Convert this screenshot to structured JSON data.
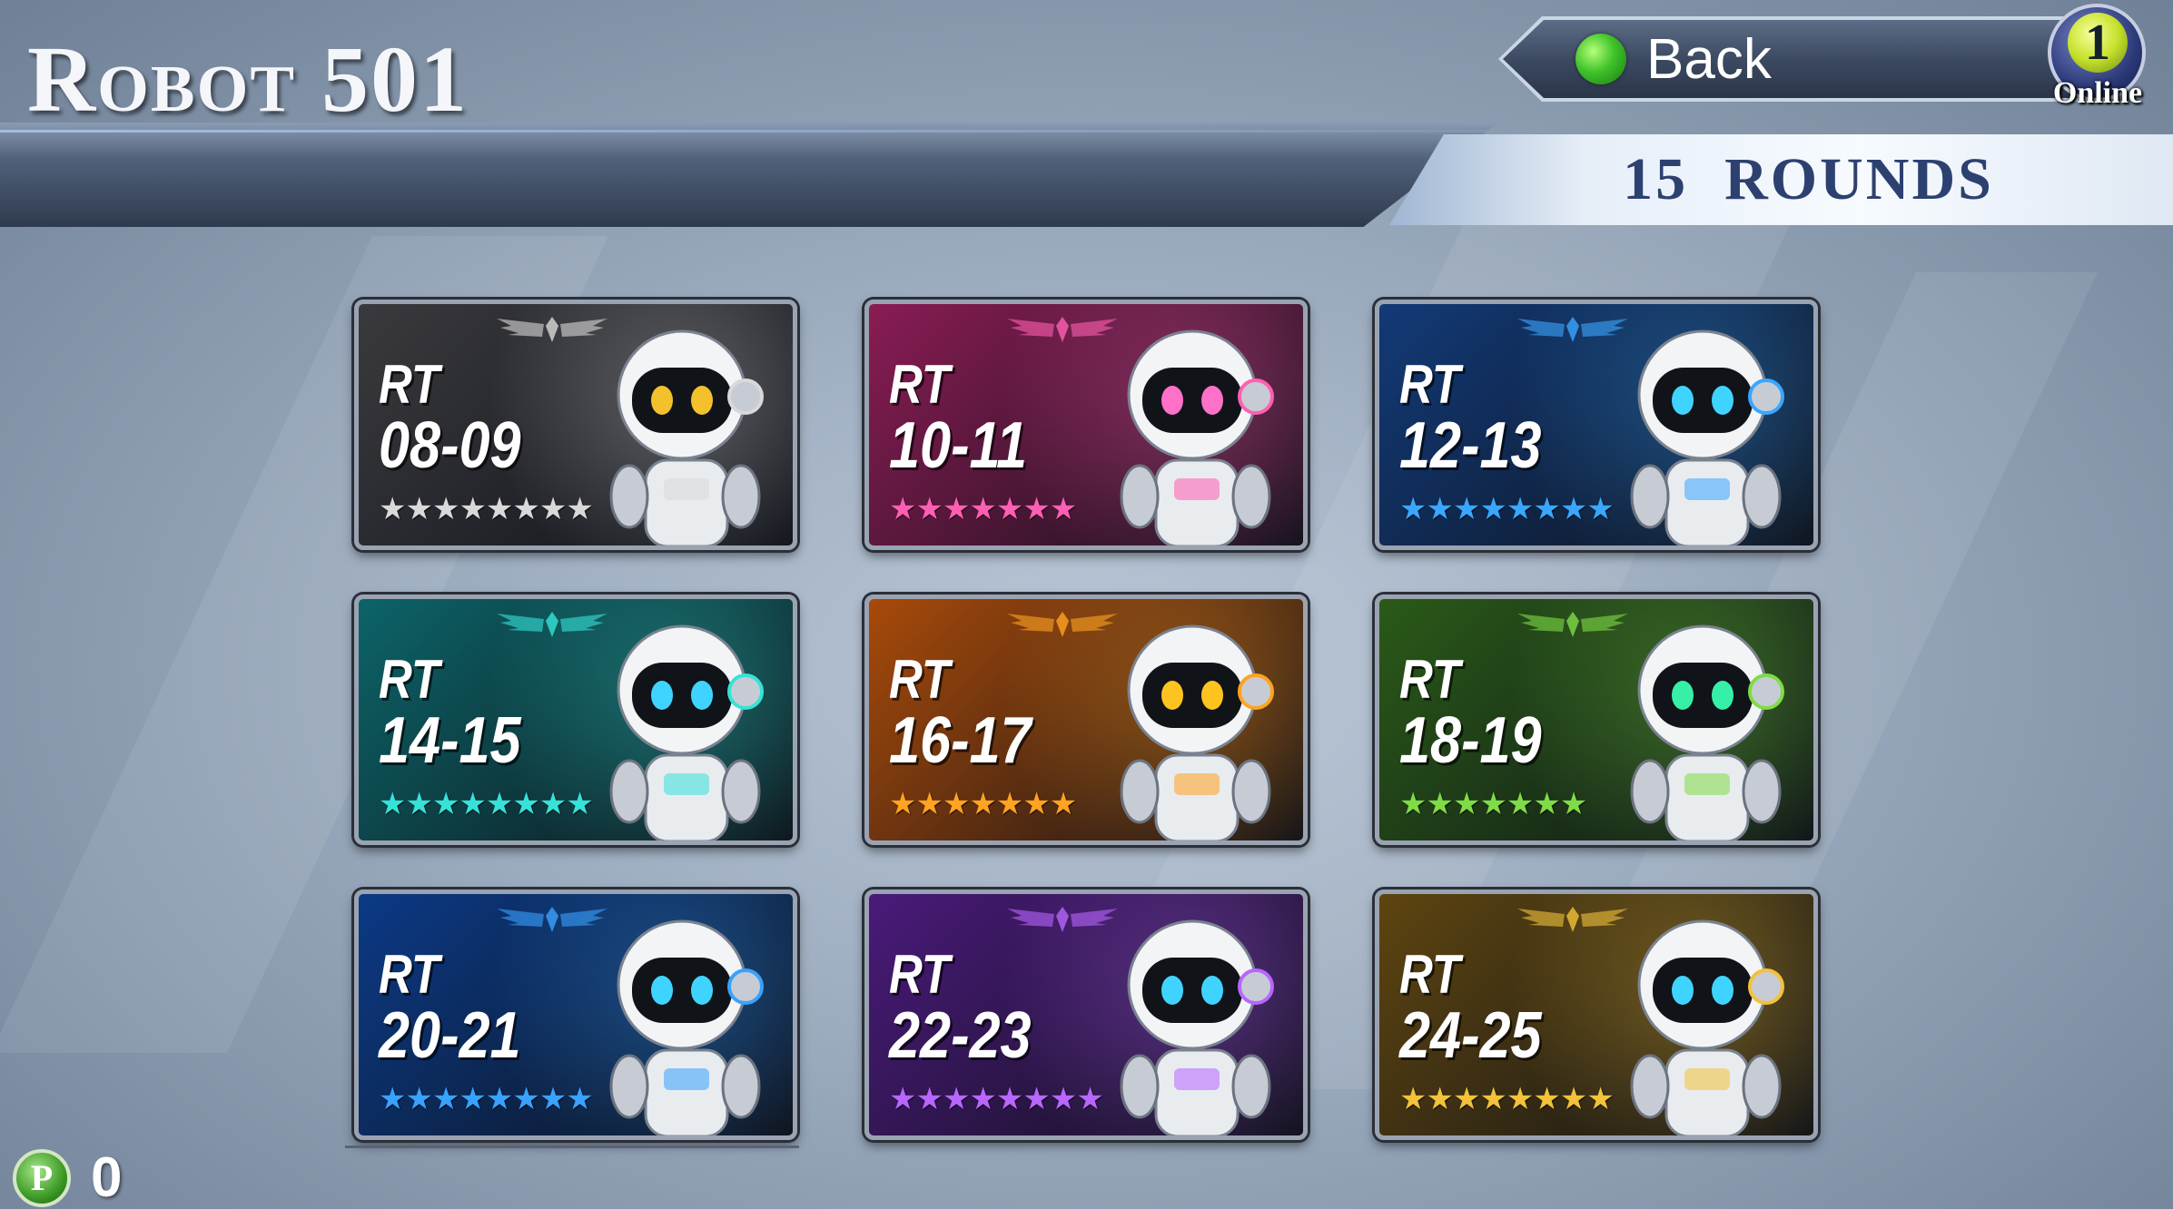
{
  "header": {
    "title": "Robot 501"
  },
  "back": {
    "label": "Back"
  },
  "online": {
    "count": "1",
    "label": "Online"
  },
  "rounds": {
    "count": "15",
    "label": "ROUNDS"
  },
  "cards": [
    {
      "rt": "RT",
      "range": "08-09",
      "stars": "★★★★★★★★",
      "theme": "#3a3a3e",
      "accent": "#d9d9d9",
      "eye": "#f2c12b"
    },
    {
      "rt": "RT",
      "range": "10-11",
      "stars": "★★★★★★★",
      "theme": "#8a1c54",
      "accent": "#ff5fb3",
      "eye": "#ff70c8"
    },
    {
      "rt": "RT",
      "range": "12-13",
      "stars": "★★★★★★★★",
      "theme": "#123a78",
      "accent": "#3aa6ff",
      "eye": "#3fd4ff"
    },
    {
      "rt": "RT",
      "range": "14-15",
      "stars": "★★★★★★★★",
      "theme": "#0c6468",
      "accent": "#36e2d8",
      "eye": "#3fd4ff"
    },
    {
      "rt": "RT",
      "range": "16-17",
      "stars": "★★★★★★★",
      "theme": "#a84a0a",
      "accent": "#ffa321",
      "eye": "#ffc31f"
    },
    {
      "rt": "RT",
      "range": "18-19",
      "stars": "★★★★★★★",
      "theme": "#2a5a18",
      "accent": "#7fdc46",
      "eye": "#36f0a8"
    },
    {
      "rt": "RT",
      "range": "20-21",
      "stars": "★★★★★★★★",
      "theme": "#0b3a86",
      "accent": "#39a2ff",
      "eye": "#3fd4ff"
    },
    {
      "rt": "RT",
      "range": "22-23",
      "stars": "★★★★★★★★",
      "theme": "#4a1a7a",
      "accent": "#b866ff",
      "eye": "#3fd4ff"
    },
    {
      "rt": "RT",
      "range": "24-25",
      "stars": "★★★★★★★★",
      "theme": "#5e4510",
      "accent": "#f2c23a",
      "eye": "#3fd4ff"
    }
  ],
  "points": {
    "icon": "P",
    "value": "0"
  }
}
